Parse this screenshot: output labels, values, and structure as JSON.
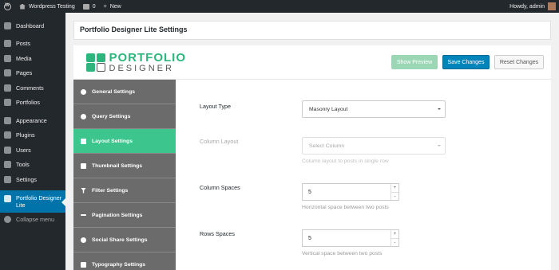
{
  "adminbar": {
    "site_name": "Wordpress Testing",
    "comments_count": "0",
    "new_label": "New",
    "howdy": "Howdy, admin"
  },
  "sidebar": {
    "items": [
      {
        "label": "Dashboard",
        "icon": "dashboard-icon"
      },
      {
        "label": "Posts",
        "icon": "pin-icon"
      },
      {
        "label": "Media",
        "icon": "media-icon"
      },
      {
        "label": "Pages",
        "icon": "page-icon"
      },
      {
        "label": "Comments",
        "icon": "comment-icon"
      },
      {
        "label": "Portfolios",
        "icon": "portfolio-icon"
      },
      {
        "label": "Appearance",
        "icon": "brush-icon"
      },
      {
        "label": "Plugins",
        "icon": "plugin-icon"
      },
      {
        "label": "Users",
        "icon": "user-icon"
      },
      {
        "label": "Tools",
        "icon": "wrench-icon"
      },
      {
        "label": "Settings",
        "icon": "settings-icon"
      },
      {
        "label": "Portfolio Designer Lite",
        "icon": "portfolio-designer-icon"
      },
      {
        "label": "Collapse menu",
        "icon": "collapse-icon"
      }
    ]
  },
  "page": {
    "title": "Portfolio Designer Lite Settings"
  },
  "brand": {
    "line1": "PORTFOLIO",
    "line2": "DESIGNER"
  },
  "buttons": {
    "preview": "Show Preview",
    "save": "Save Changes",
    "reset": "Reset Changes"
  },
  "tabs": [
    {
      "label": "General Settings",
      "icon": "gear-icon"
    },
    {
      "label": "Query Settings",
      "icon": "query-icon"
    },
    {
      "label": "Layout Settings",
      "icon": "grid-icon",
      "active": true
    },
    {
      "label": "Thumbnail Settings",
      "icon": "image-icon"
    },
    {
      "label": "Filter Settings",
      "icon": "filter-icon"
    },
    {
      "label": "Pagination Settings",
      "icon": "dots-icon"
    },
    {
      "label": "Social Share Settings",
      "icon": "share-icon"
    },
    {
      "label": "Typography Settings",
      "icon": "typography-icon"
    }
  ],
  "form": {
    "layout_type": {
      "label": "Layout Type",
      "value": "Masonry Layout"
    },
    "column_layout": {
      "label": "Column Layout",
      "placeholder": "Select Column",
      "hint": "Column layout to posts in single row"
    },
    "column_spaces": {
      "label": "Column Spaces",
      "value": "5",
      "hint": "Horizontal space between two posts"
    },
    "rows_spaces": {
      "label": "Rows Spaces",
      "value": "5",
      "hint": "Vertical space between two posts"
    }
  },
  "colors": {
    "accent_green": "#3cc58c",
    "wp_blue": "#0085ba",
    "admin_dark": "#23282d"
  }
}
